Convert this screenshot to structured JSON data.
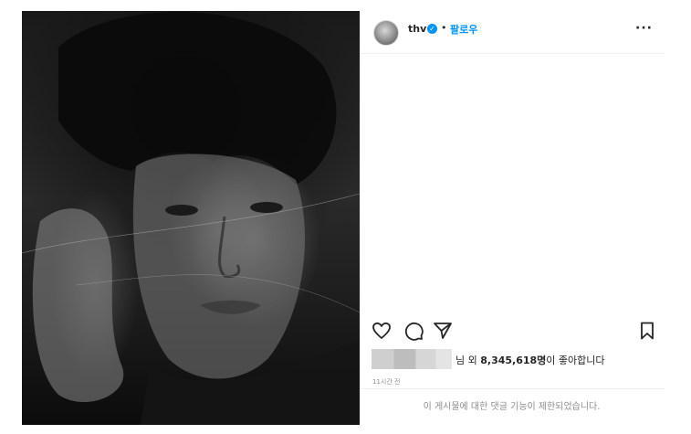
{
  "post": {
    "image_alt": "흑백 인물 사진"
  },
  "header": {
    "username": "thv",
    "verified_icon": "verified-badge-icon",
    "separator": "•",
    "follow_label": "팔로우",
    "more_label": "···"
  },
  "actions": {
    "like_icon": "heart-icon",
    "comment_icon": "comment-icon",
    "share_icon": "send-icon",
    "save_icon": "bookmark-icon"
  },
  "likes": {
    "suffix_prefix": "님 외 ",
    "count": "8,345,618명",
    "suffix": "이 좋아합니다"
  },
  "timestamp": "11시간 전",
  "comments_notice": "이 게시물에 대한 댓글 기능이 제한되었습니다.",
  "colors": {
    "accent": "#0095f6",
    "text": "#262626",
    "muted": "#8e8e8e"
  }
}
